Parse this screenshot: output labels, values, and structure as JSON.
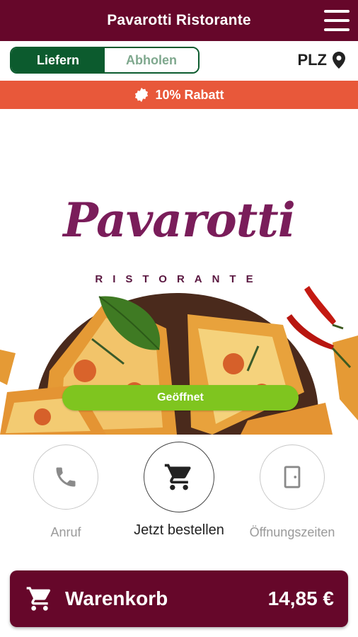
{
  "header": {
    "title": "Pavarotti Ristorante"
  },
  "mode": {
    "deliver_label": "Liefern",
    "pickup_label": "Abholen",
    "postal_label": "PLZ"
  },
  "banner": {
    "text": "10% Rabatt"
  },
  "hero": {
    "logo_title": "Pavarotti",
    "logo_subtitle": "RISTORANTE",
    "status_label": "Geöffnet"
  },
  "actions": [
    {
      "label": "Anruf",
      "icon": "phone-icon"
    },
    {
      "label": "Jetzt bestellen",
      "icon": "cart-icon"
    },
    {
      "label": "Öffnungszeiten",
      "icon": "door-icon"
    }
  ],
  "cart": {
    "label": "Warenkorb",
    "total": "14,85 €"
  },
  "colors": {
    "primary": "#66072a",
    "toggle_green": "#0c5b2e",
    "banner_orange": "#e8583a",
    "open_green": "#7fc51f"
  }
}
